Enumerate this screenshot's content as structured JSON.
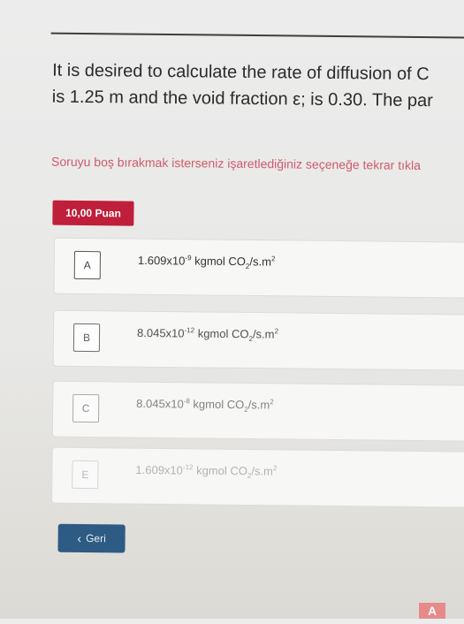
{
  "question": {
    "line1": "It is desired to calculate the rate of diffusion of C",
    "line2": "is 1.25 m and the void fraction ε; is 0.30. The par"
  },
  "hint": "Soruyu boş bırakmak isterseniz işaretlediğiniz seçeneğe tekrar tıkla",
  "points_badge": "10,00 Puan",
  "options": [
    {
      "letter": "A",
      "mantissa": "1.609x10",
      "exponent": "-9",
      "unit_prefix": "kgmol CO",
      "unit_sub": "2",
      "unit_suffix": "/s.m",
      "unit_sup": "2"
    },
    {
      "letter": "B",
      "mantissa": "8.045x10",
      "exponent": "-12",
      "unit_prefix": "kgmol CO",
      "unit_sub": "2",
      "unit_suffix": "/s.m",
      "unit_sup": "2"
    },
    {
      "letter": "C",
      "mantissa": "8.045x10",
      "exponent": "-8",
      "unit_prefix": "kgmol CO",
      "unit_sub": "2",
      "unit_suffix": "/s.m",
      "unit_sup": "2"
    },
    {
      "letter": "E",
      "mantissa": "1.609x10",
      "exponent": "-12",
      "unit_prefix": "kgmol CO",
      "unit_sub": "2",
      "unit_suffix": "/s.m",
      "unit_sup": "2"
    }
  ],
  "back_button": {
    "label": "Geri",
    "icon": "chevron-left-icon"
  },
  "corner": {
    "label": "A",
    "color": "#e78a8a"
  },
  "colors": {
    "badge": "#bf1f3a",
    "hint": "#cf5a6a",
    "back_button": "#2e5b83"
  }
}
